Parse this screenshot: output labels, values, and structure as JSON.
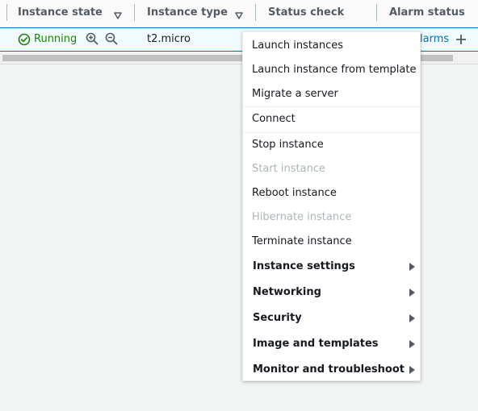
{
  "table": {
    "columns": [
      {
        "label": "Instance state"
      },
      {
        "label": "Instance type"
      },
      {
        "label": "Status check"
      },
      {
        "label": "Alarm status"
      }
    ],
    "row": {
      "state": "Running",
      "type": "t2.micro",
      "alarm_link": "larms"
    }
  },
  "actions_menu": {
    "items": [
      {
        "label": "Launch instances",
        "enabled": true
      },
      {
        "label": "Launch instance from template",
        "enabled": true
      },
      {
        "label": "Migrate a server",
        "enabled": true
      },
      {
        "label": "Connect",
        "enabled": true
      },
      {
        "label": "Stop instance",
        "enabled": true
      },
      {
        "label": "Start instance",
        "enabled": false
      },
      {
        "label": "Reboot instance",
        "enabled": true
      },
      {
        "label": "Hibernate instance",
        "enabled": false
      },
      {
        "label": "Terminate instance",
        "enabled": true
      }
    ],
    "submenus": [
      {
        "label": "Instance settings"
      },
      {
        "label": "Networking"
      },
      {
        "label": "Security"
      },
      {
        "label": "Image and templates"
      },
      {
        "label": "Monitor and troubleshoot"
      }
    ]
  },
  "colors": {
    "running": "#1d8102",
    "link": "#0073bb",
    "disabled": "#aab7b8",
    "selected_row_border": "#0073bb"
  },
  "icons": {
    "status": "check-circle-icon",
    "zoom_in": "zoom-in-icon",
    "zoom_out": "zoom-out-icon",
    "add": "plus-icon",
    "sort": "sort-triangle-icon",
    "submenu": "caret-right-icon"
  }
}
